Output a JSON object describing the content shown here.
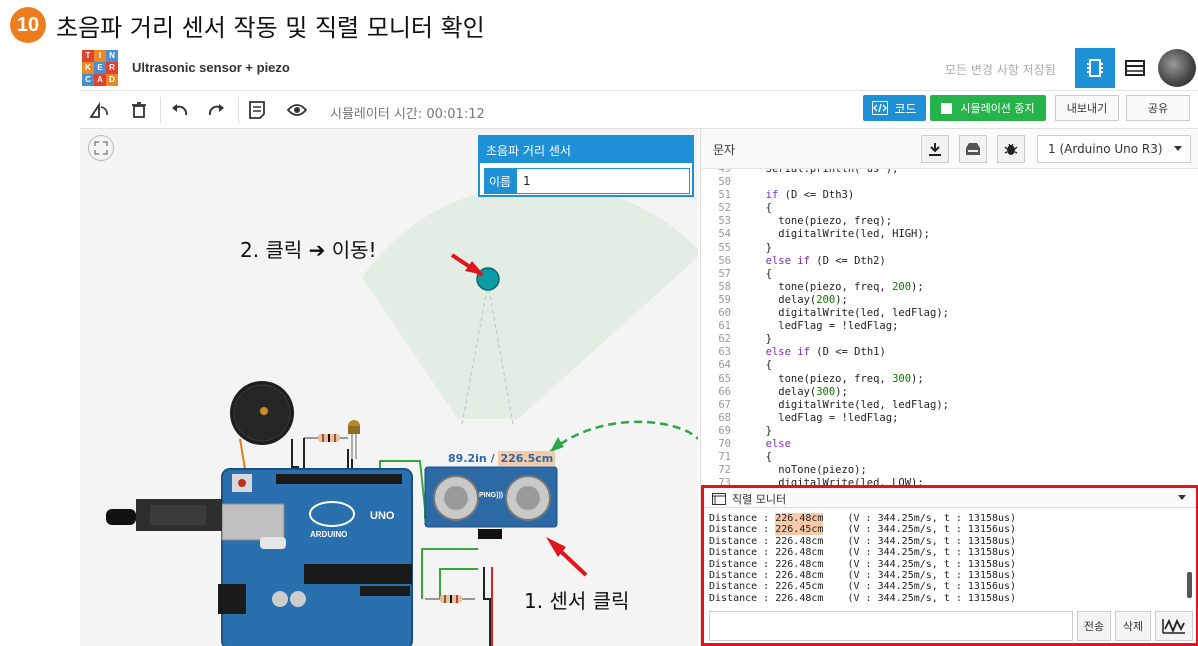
{
  "heading": {
    "step": "10",
    "title": "초음파 거리 센서 작동 및 직렬 모니터 확인"
  },
  "app": {
    "logo_letters": [
      "T",
      "I",
      "N",
      "K",
      "E",
      "R",
      "C",
      "A",
      "D"
    ],
    "logo_colors": [
      "#e2402f",
      "#e98a27",
      "#4a8fd0",
      "#e98a27",
      "#4a8fd0",
      "#e2402f",
      "#4a8fd0",
      "#e2402f",
      "#e98a27"
    ],
    "project_name": "Ultrasonic sensor + piezo",
    "saved_status": "모든 변경 사항 저장됨",
    "accent_color": "#1e90d6",
    "sim_color": "#26b34a"
  },
  "toolbar": {
    "sim_time": "시뮬레이터 시간: 00:01:12",
    "code_label": "코드",
    "stop_label": "시뮬레이션 중지",
    "export_label": "내보내기",
    "share_label": "공유"
  },
  "canvas": {
    "prop_title": "초음파 거리 센서",
    "prop_name_label": "이름",
    "prop_name_value": "1",
    "distance_in": "89.2in",
    "distance_sep": " / ",
    "distance_cm": "226.5cm",
    "sensor_label": "PING)))",
    "annot_move": "2. 클릭 ➔ 이동!",
    "annot_click": "1. 센서 클릭"
  },
  "code": {
    "header_label": "문자",
    "board": "1 (Arduino Uno R3)",
    "lines": [
      {
        "n": "49",
        "parts": [
          {
            "t": "  Serial.println(\"us\");",
            "c": "tx"
          }
        ]
      },
      {
        "n": "50",
        "parts": [
          {
            "t": "",
            "c": "tx"
          }
        ]
      },
      {
        "n": "51",
        "parts": [
          {
            "t": "  ",
            "c": "tx"
          },
          {
            "t": "if",
            "c": "kw"
          },
          {
            "t": " (D <= Dth3)",
            "c": "tx"
          }
        ]
      },
      {
        "n": "52",
        "parts": [
          {
            "t": "  {",
            "c": "tx"
          }
        ]
      },
      {
        "n": "53",
        "parts": [
          {
            "t": "    tone(piezo, freq);",
            "c": "tx"
          }
        ]
      },
      {
        "n": "54",
        "parts": [
          {
            "t": "    digitalWrite(led, HIGH);",
            "c": "tx"
          }
        ]
      },
      {
        "n": "55",
        "parts": [
          {
            "t": "  }",
            "c": "tx"
          }
        ]
      },
      {
        "n": "56",
        "parts": [
          {
            "t": "  ",
            "c": "tx"
          },
          {
            "t": "else if",
            "c": "kw"
          },
          {
            "t": " (D <= Dth2)",
            "c": "tx"
          }
        ]
      },
      {
        "n": "57",
        "parts": [
          {
            "t": "  {",
            "c": "tx"
          }
        ]
      },
      {
        "n": "58",
        "parts": [
          {
            "t": "    tone(piezo, freq, ",
            "c": "tx"
          },
          {
            "t": "200",
            "c": "nm"
          },
          {
            "t": ");",
            "c": "tx"
          }
        ]
      },
      {
        "n": "59",
        "parts": [
          {
            "t": "    delay(",
            "c": "tx"
          },
          {
            "t": "200",
            "c": "nm"
          },
          {
            "t": ");",
            "c": "tx"
          }
        ]
      },
      {
        "n": "60",
        "parts": [
          {
            "t": "    digitalWrite(led, ledFlag);",
            "c": "tx"
          }
        ]
      },
      {
        "n": "61",
        "parts": [
          {
            "t": "    ledFlag = !ledFlag;",
            "c": "tx"
          }
        ]
      },
      {
        "n": "62",
        "parts": [
          {
            "t": "  }",
            "c": "tx"
          }
        ]
      },
      {
        "n": "63",
        "parts": [
          {
            "t": "  ",
            "c": "tx"
          },
          {
            "t": "else if",
            "c": "kw"
          },
          {
            "t": " (D <= Dth1)",
            "c": "tx"
          }
        ]
      },
      {
        "n": "64",
        "parts": [
          {
            "t": "  {",
            "c": "tx"
          }
        ]
      },
      {
        "n": "65",
        "parts": [
          {
            "t": "    tone(piezo, freq, ",
            "c": "tx"
          },
          {
            "t": "300",
            "c": "nm"
          },
          {
            "t": ");",
            "c": "tx"
          }
        ]
      },
      {
        "n": "66",
        "parts": [
          {
            "t": "    delay(",
            "c": "tx"
          },
          {
            "t": "300",
            "c": "nm"
          },
          {
            "t": ");",
            "c": "tx"
          }
        ]
      },
      {
        "n": "67",
        "parts": [
          {
            "t": "    digitalWrite(led, ledFlag);",
            "c": "tx"
          }
        ]
      },
      {
        "n": "68",
        "parts": [
          {
            "t": "    ledFlag = !ledFlag;",
            "c": "tx"
          }
        ]
      },
      {
        "n": "69",
        "parts": [
          {
            "t": "  }",
            "c": "tx"
          }
        ]
      },
      {
        "n": "70",
        "parts": [
          {
            "t": "  ",
            "c": "tx"
          },
          {
            "t": "else",
            "c": "kw"
          }
        ]
      },
      {
        "n": "71",
        "parts": [
          {
            "t": "  {",
            "c": "tx"
          }
        ]
      },
      {
        "n": "72",
        "parts": [
          {
            "t": "    noTone(piezo);",
            "c": "tx"
          }
        ]
      },
      {
        "n": "73",
        "parts": [
          {
            "t": "    digitalWrite(led, LOW);",
            "c": "tx"
          }
        ]
      }
    ]
  },
  "serial": {
    "title": "직렬 모니터",
    "lines": [
      {
        "a": "Distance : ",
        "v": "226.48cm",
        "r": "    (V : 344.25m/s, t : 13158us)",
        "hl": true
      },
      {
        "a": "Distance : ",
        "v": "226.45cm",
        "r": "    (V : 344.25m/s, t : 13156us)",
        "hl": true
      },
      {
        "a": "Distance : ",
        "v": "226.48cm",
        "r": "    (V : 344.25m/s, t : 13158us)",
        "hl": false
      },
      {
        "a": "Distance : ",
        "v": "226.48cm",
        "r": "    (V : 344.25m/s, t : 13158us)",
        "hl": false
      },
      {
        "a": "Distance : ",
        "v": "226.48cm",
        "r": "    (V : 344.25m/s, t : 13158us)",
        "hl": false
      },
      {
        "a": "Distance : ",
        "v": "226.48cm",
        "r": "    (V : 344.25m/s, t : 13158us)",
        "hl": false
      },
      {
        "a": "Distance : ",
        "v": "226.45cm",
        "r": "    (V : 344.25m/s, t : 13156us)",
        "hl": false
      },
      {
        "a": "Distance : ",
        "v": "226.48cm",
        "r": "    (V : 344.25m/s, t : 13158us)",
        "hl": false
      }
    ],
    "input_value": "",
    "send_label": "전송",
    "clear_label": "삭제"
  }
}
